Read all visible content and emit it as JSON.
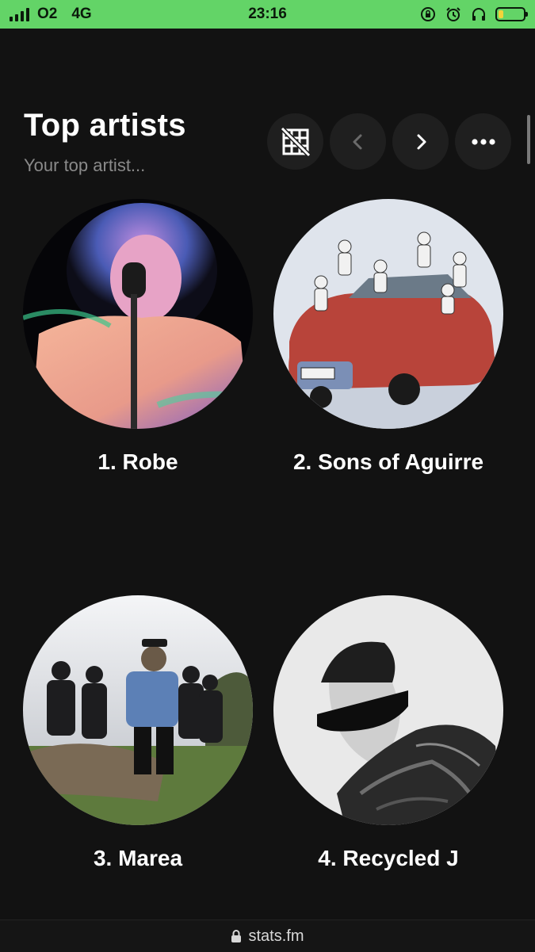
{
  "status_bar": {
    "carrier": "O2",
    "network": "4G",
    "time": "23:16",
    "icons": [
      "signal-icon",
      "rotation-lock-icon",
      "alarm-icon",
      "headphones-icon",
      "battery-icon"
    ],
    "battery_level": 0.2,
    "background": "#63d467"
  },
  "section": {
    "title": "Top artists",
    "subtitle": "Your top artist..."
  },
  "controls": {
    "icons": [
      "grid-off-icon",
      "chevron-left-icon",
      "chevron-right-icon",
      "more-icon"
    ]
  },
  "artists": [
    {
      "label": "1. Robe"
    },
    {
      "label": "2. Sons of Aguirre"
    },
    {
      "label": "3. Marea"
    },
    {
      "label": "4. Recycled J"
    }
  ],
  "url_bar": {
    "domain": "stats.fm"
  }
}
